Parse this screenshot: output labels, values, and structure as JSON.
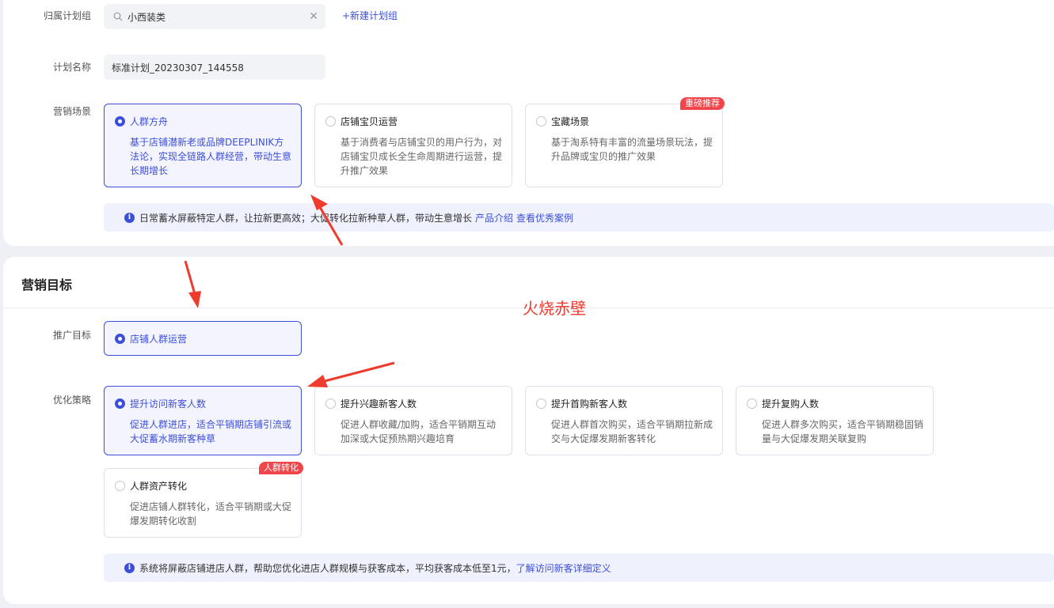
{
  "plan_group": {
    "label": "归属计划组",
    "value": "小西装类",
    "new_group_link": "+新建计划组"
  },
  "plan_name": {
    "label": "计划名称",
    "value": "标准计划_20230307_144558"
  },
  "scene": {
    "label": "营销场景",
    "cards": [
      {
        "title": "人群方舟",
        "desc": "基于店铺潜新老或品牌DEEPLINIK方法论，实现全链路人群经营，带动生意长期增长",
        "selected": true
      },
      {
        "title": "店铺宝贝运营",
        "desc": "基于消费者与店铺宝贝的用户行为，对店铺宝贝成长全生命周期进行运营，提升推广效果",
        "selected": false
      },
      {
        "title": "宝藏场景",
        "desc": "基于淘系特有丰富的流量场景玩法，提升品牌或宝贝的推广效果",
        "selected": false,
        "badge": "重磅推荐"
      }
    ],
    "tip": {
      "text": "日常蓄水屏蔽特定人群，让拉新更高效；大促转化拉新种草人群，带动生意增长",
      "link1": "产品介绍",
      "link2": "查看优秀案例"
    }
  },
  "goal_section": {
    "title": "营销目标"
  },
  "promo_goal": {
    "label": "推广目标",
    "card": {
      "title": "店铺人群运营",
      "selected": true
    }
  },
  "strategy": {
    "label": "优化策略",
    "cards": [
      {
        "title": "提升访问新客人数",
        "desc": "促进人群进店，适合平销期店铺引流或大促蓄水期新客种草",
        "selected": true
      },
      {
        "title": "提升兴趣新客人数",
        "desc": "促进人群收藏/加购，适合平销期互动加深或大促预热期兴趣培育",
        "selected": false
      },
      {
        "title": "提升首购新客人数",
        "desc": "促进人群首次购买，适合平销期拉新成交与大促爆发期新客转化",
        "selected": false
      },
      {
        "title": "提升复购人数",
        "desc": "促进人群多次购买，适合平销期稳固销量与大促爆发期关联复购",
        "selected": false
      },
      {
        "title": "人群资产转化",
        "desc": "促进店铺人群转化，适合平销期或大促爆发期转化收割",
        "selected": false,
        "badge": "人群转化"
      }
    ],
    "tip": {
      "text": "系统将屏蔽店铺进店人群，帮助您优化进店人群规模与获客成本，平均获客成本低至1元，",
      "link": "了解访问新客详细定义"
    }
  },
  "annotation": {
    "text": "火烧赤壁",
    "color": "#ef3b2d"
  }
}
